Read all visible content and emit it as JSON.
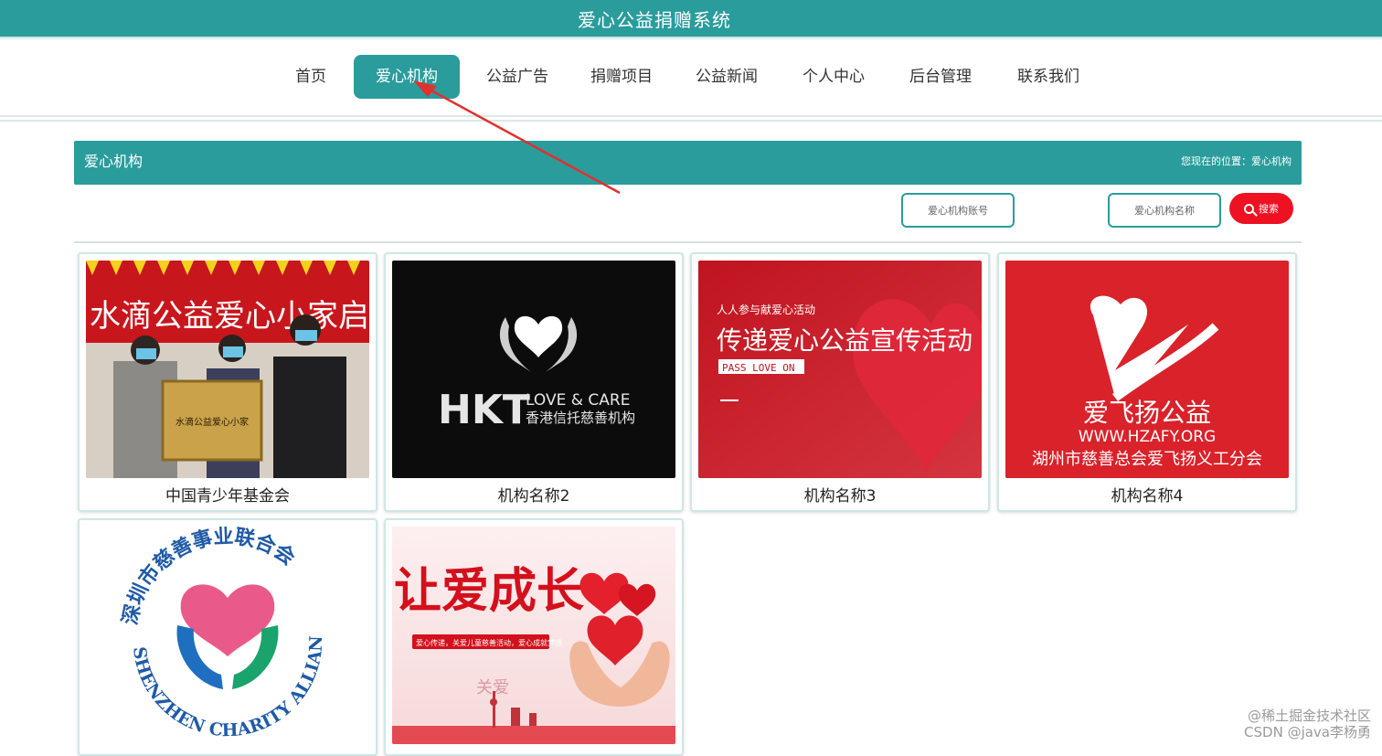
{
  "header": {
    "title": "爱心公益捐赠系统"
  },
  "nav": {
    "items": [
      {
        "label": "首页"
      },
      {
        "label": "爱心机构",
        "active": true
      },
      {
        "label": "公益广告"
      },
      {
        "label": "捐赠项目"
      },
      {
        "label": "公益新闻"
      },
      {
        "label": "个人中心"
      },
      {
        "label": "后台管理"
      },
      {
        "label": "联系我们"
      }
    ]
  },
  "section": {
    "title": "爱心机构",
    "breadcrumb": "您现在的位置：爱心机构"
  },
  "search": {
    "account_placeholder": "爱心机构账号",
    "name_placeholder": "爱心机构名称",
    "button_label": "搜索"
  },
  "cards": [
    {
      "name": "中国青少年基金会",
      "banner": "水滴公益爱心小家启动会",
      "plaque": "水滴公益爱心小家"
    },
    {
      "name": "机构名称2",
      "logo_big": "HKT",
      "logo_line1": "LOVE & CARE",
      "logo_line2": "香港信托慈善机构"
    },
    {
      "name": "机构名称3",
      "small": "人人参与献爱心活动",
      "big": "传递爱心公益宣传活动",
      "tag": "PASS LOVE ON"
    },
    {
      "name": "机构名称4",
      "line1": "爱飞扬公益",
      "line2": "WWW.HZAFY.ORG",
      "line3": "湖州市慈善总会爱飞扬义工分会"
    },
    {
      "name": "",
      "seal_cn": "深圳市慈善事业联合会",
      "seal_en": "SHENZHEN CHARITY ALLIANCE"
    },
    {
      "name": "",
      "big": "让爱成长",
      "sub": "爱心传递，关爱儿童慈善活动，爱心成就梦想",
      "word": "关爱"
    }
  ],
  "watermark": {
    "line1": "@稀土掘金技术社区",
    "line2": "CSDN @java李杨勇"
  },
  "colors": {
    "theme": "#2a9c9c",
    "search_button": "#ee1122",
    "arrow": "#e03030"
  }
}
